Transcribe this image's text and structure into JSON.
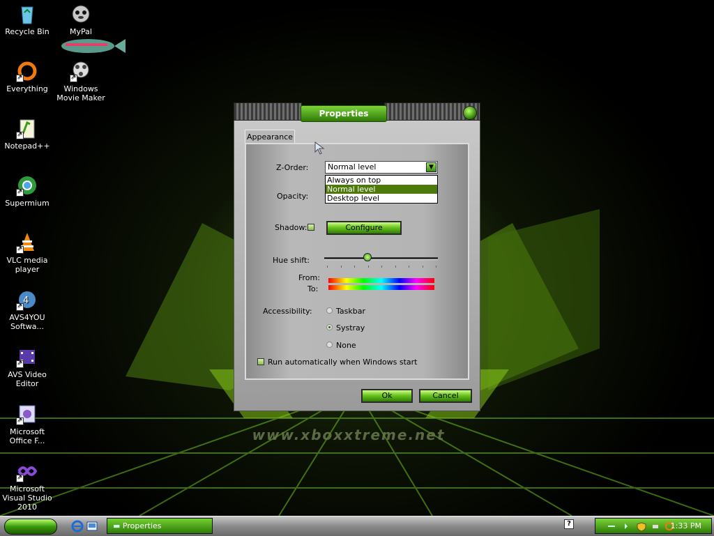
{
  "desktop": {
    "watermark": "www.xboxxtreme.net",
    "icons": [
      {
        "label": "Recycle Bin",
        "icon": "recycle-bin-icon"
      },
      {
        "label": "MyPal",
        "icon": "mypal-icon"
      },
      {
        "label": "Everything",
        "icon": "everything-icon"
      },
      {
        "label": "Windows Movie Maker",
        "icon": "movie-maker-icon"
      },
      {
        "label": "Notepad++",
        "icon": "notepadpp-icon"
      },
      {
        "label": "Supermium",
        "icon": "supermium-icon"
      },
      {
        "label": "VLC media player",
        "icon": "vlc-icon"
      },
      {
        "label": "AVS4YOU Softwa...",
        "icon": "avs4you-icon"
      },
      {
        "label": "AVS Video Editor",
        "icon": "avs-video-editor-icon"
      },
      {
        "label": "Microsoft Office F...",
        "icon": "office-icon"
      },
      {
        "label": "Microsoft Visual Studio 2010",
        "icon": "visual-studio-icon"
      }
    ]
  },
  "window": {
    "title": "Properties",
    "tab": "Appearance",
    "z_order": {
      "label": "Z-Order:",
      "value": "Normal level",
      "options": [
        "Always on top",
        "Normal level",
        "Desktop level"
      ]
    },
    "opacity_label": "Opacity:",
    "shadow": {
      "label": "Shadow:",
      "checked": false,
      "configure_label": "Configure"
    },
    "hue_shift": {
      "label": "Hue shift:",
      "value_fraction": 0.37,
      "from_label": "From:",
      "to_label": "To:"
    },
    "accessibility": {
      "label": "Accessibility:",
      "options": [
        {
          "label": "Taskbar",
          "selected": false
        },
        {
          "label": "Systray",
          "selected": true
        },
        {
          "label": "None",
          "selected": false
        }
      ]
    },
    "autorun": {
      "label": "Run automatically when Windows start",
      "checked": false
    },
    "ok_label": "Ok",
    "cancel_label": "Cancel"
  },
  "taskbar": {
    "task_label": "Properties",
    "clock": "1:33 PM",
    "help_glyph": "?"
  },
  "colors": {
    "accent": "#3a8a0a",
    "selection": "#4e7a0a"
  }
}
